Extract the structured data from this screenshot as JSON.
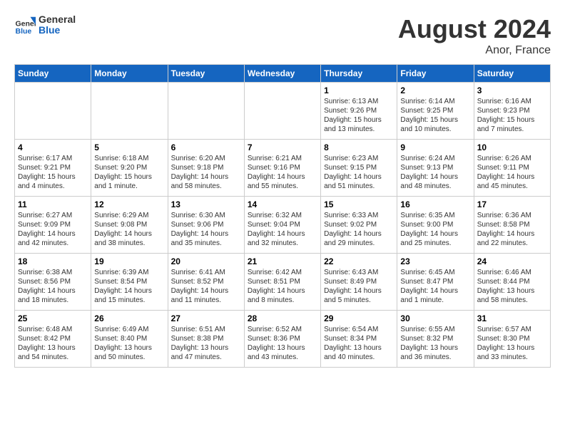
{
  "header": {
    "logo_general": "General",
    "logo_blue": "Blue",
    "month_year": "August 2024",
    "location": "Anor, France"
  },
  "weekdays": [
    "Sunday",
    "Monday",
    "Tuesday",
    "Wednesday",
    "Thursday",
    "Friday",
    "Saturday"
  ],
  "weeks": [
    [
      {
        "day": "",
        "info": ""
      },
      {
        "day": "",
        "info": ""
      },
      {
        "day": "",
        "info": ""
      },
      {
        "day": "",
        "info": ""
      },
      {
        "day": "1",
        "info": "Sunrise: 6:13 AM\nSunset: 9:26 PM\nDaylight: 15 hours\nand 13 minutes."
      },
      {
        "day": "2",
        "info": "Sunrise: 6:14 AM\nSunset: 9:25 PM\nDaylight: 15 hours\nand 10 minutes."
      },
      {
        "day": "3",
        "info": "Sunrise: 6:16 AM\nSunset: 9:23 PM\nDaylight: 15 hours\nand 7 minutes."
      }
    ],
    [
      {
        "day": "4",
        "info": "Sunrise: 6:17 AM\nSunset: 9:21 PM\nDaylight: 15 hours\nand 4 minutes."
      },
      {
        "day": "5",
        "info": "Sunrise: 6:18 AM\nSunset: 9:20 PM\nDaylight: 15 hours\nand 1 minute."
      },
      {
        "day": "6",
        "info": "Sunrise: 6:20 AM\nSunset: 9:18 PM\nDaylight: 14 hours\nand 58 minutes."
      },
      {
        "day": "7",
        "info": "Sunrise: 6:21 AM\nSunset: 9:16 PM\nDaylight: 14 hours\nand 55 minutes."
      },
      {
        "day": "8",
        "info": "Sunrise: 6:23 AM\nSunset: 9:15 PM\nDaylight: 14 hours\nand 51 minutes."
      },
      {
        "day": "9",
        "info": "Sunrise: 6:24 AM\nSunset: 9:13 PM\nDaylight: 14 hours\nand 48 minutes."
      },
      {
        "day": "10",
        "info": "Sunrise: 6:26 AM\nSunset: 9:11 PM\nDaylight: 14 hours\nand 45 minutes."
      }
    ],
    [
      {
        "day": "11",
        "info": "Sunrise: 6:27 AM\nSunset: 9:09 PM\nDaylight: 14 hours\nand 42 minutes."
      },
      {
        "day": "12",
        "info": "Sunrise: 6:29 AM\nSunset: 9:08 PM\nDaylight: 14 hours\nand 38 minutes."
      },
      {
        "day": "13",
        "info": "Sunrise: 6:30 AM\nSunset: 9:06 PM\nDaylight: 14 hours\nand 35 minutes."
      },
      {
        "day": "14",
        "info": "Sunrise: 6:32 AM\nSunset: 9:04 PM\nDaylight: 14 hours\nand 32 minutes."
      },
      {
        "day": "15",
        "info": "Sunrise: 6:33 AM\nSunset: 9:02 PM\nDaylight: 14 hours\nand 29 minutes."
      },
      {
        "day": "16",
        "info": "Sunrise: 6:35 AM\nSunset: 9:00 PM\nDaylight: 14 hours\nand 25 minutes."
      },
      {
        "day": "17",
        "info": "Sunrise: 6:36 AM\nSunset: 8:58 PM\nDaylight: 14 hours\nand 22 minutes."
      }
    ],
    [
      {
        "day": "18",
        "info": "Sunrise: 6:38 AM\nSunset: 8:56 PM\nDaylight: 14 hours\nand 18 minutes."
      },
      {
        "day": "19",
        "info": "Sunrise: 6:39 AM\nSunset: 8:54 PM\nDaylight: 14 hours\nand 15 minutes."
      },
      {
        "day": "20",
        "info": "Sunrise: 6:41 AM\nSunset: 8:52 PM\nDaylight: 14 hours\nand 11 minutes."
      },
      {
        "day": "21",
        "info": "Sunrise: 6:42 AM\nSunset: 8:51 PM\nDaylight: 14 hours\nand 8 minutes."
      },
      {
        "day": "22",
        "info": "Sunrise: 6:43 AM\nSunset: 8:49 PM\nDaylight: 14 hours\nand 5 minutes."
      },
      {
        "day": "23",
        "info": "Sunrise: 6:45 AM\nSunset: 8:47 PM\nDaylight: 14 hours\nand 1 minute."
      },
      {
        "day": "24",
        "info": "Sunrise: 6:46 AM\nSunset: 8:44 PM\nDaylight: 13 hours\nand 58 minutes."
      }
    ],
    [
      {
        "day": "25",
        "info": "Sunrise: 6:48 AM\nSunset: 8:42 PM\nDaylight: 13 hours\nand 54 minutes."
      },
      {
        "day": "26",
        "info": "Sunrise: 6:49 AM\nSunset: 8:40 PM\nDaylight: 13 hours\nand 50 minutes."
      },
      {
        "day": "27",
        "info": "Sunrise: 6:51 AM\nSunset: 8:38 PM\nDaylight: 13 hours\nand 47 minutes."
      },
      {
        "day": "28",
        "info": "Sunrise: 6:52 AM\nSunset: 8:36 PM\nDaylight: 13 hours\nand 43 minutes."
      },
      {
        "day": "29",
        "info": "Sunrise: 6:54 AM\nSunset: 8:34 PM\nDaylight: 13 hours\nand 40 minutes."
      },
      {
        "day": "30",
        "info": "Sunrise: 6:55 AM\nSunset: 8:32 PM\nDaylight: 13 hours\nand 36 minutes."
      },
      {
        "day": "31",
        "info": "Sunrise: 6:57 AM\nSunset: 8:30 PM\nDaylight: 13 hours\nand 33 minutes."
      }
    ]
  ]
}
